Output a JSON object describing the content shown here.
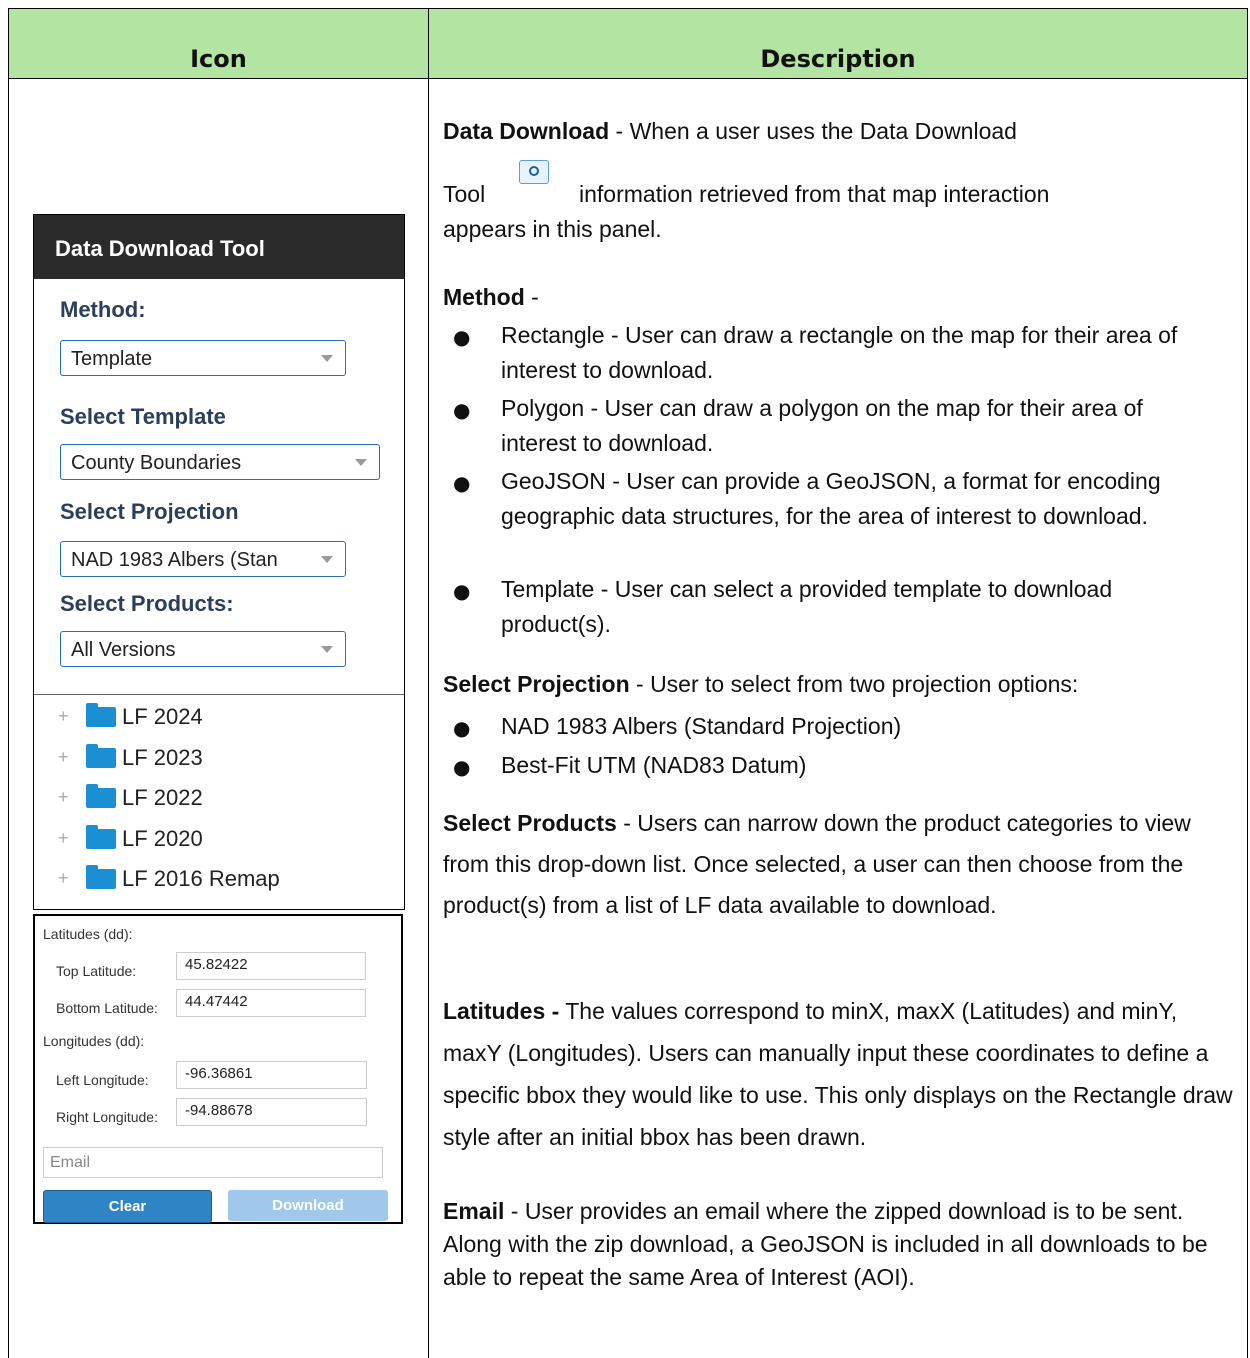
{
  "header": {
    "icon_col": "Icon",
    "description_col": "Description"
  },
  "panel": {
    "title": "Data Download Tool",
    "method_label": "Method:",
    "method_value": "Template",
    "template_label": "Select Template",
    "template_value": "County Boundaries",
    "projection_label": "Select Projection",
    "projection_value": "NAD 1983 Albers (Stan",
    "products_label": "Select Products:",
    "products_value": "All Versions",
    "tree": [
      "LF 2024",
      "LF 2023",
      "LF 2022",
      "LF 2020",
      "LF 2016 Remap"
    ]
  },
  "coords": {
    "lat_heading": "Latitudes (dd):",
    "top_lat_label": "Top Latitude:",
    "top_lat_value": "45.82422",
    "bottom_lat_label": "Bottom Latitude:",
    "bottom_lat_value": "44.47442",
    "lon_heading": "Longitudes (dd):",
    "left_lon_label": "Left Longitude:",
    "left_lon_value": "-96.36861",
    "right_lon_label": "Right Longitude:",
    "right_lon_value": "-94.88678",
    "email_placeholder": "Email",
    "clear_label": "Clear",
    "download_label": "Download",
    "clear_color": "#2f84c6",
    "download_color": "#9fc8ea"
  },
  "description": {
    "data_download_title": "Data Download",
    "data_download_text1": " - When a user uses the Data Download",
    "data_download_text2a": "Tool",
    "data_download_text2b": "information retrieved from that map interaction",
    "data_download_text3": "appears in this panel.",
    "method_title": "Method",
    "method_suffix": " -",
    "method_items": [
      "Rectangle - User can draw a rectangle on the map for their area of interest to download.",
      "Polygon - User can draw a polygon on the map for their area of interest to download.",
      "GeoJSON - User can provide a GeoJSON, a format for encoding geographic data structures, for the area of interest to download.",
      "Template - User can select a provided template to download product(s)."
    ],
    "projection_title": "Select Projection",
    "projection_text": " - User to select from two projection options:",
    "projection_items": [
      "NAD 1983 Albers (Standard Projection)",
      "Best-Fit UTM (NAD83 Datum)"
    ],
    "products_title": "Select Products",
    "products_text": " - Users can narrow down the product categories to view from this drop-down list. Once selected, a user can then choose from the product(s) from a list of LF data available to download.",
    "latitudes_title": "Latitudes -",
    "latitudes_text": " The values correspond to minX, maxX (Latitudes) and minY, maxY (Longitudes). Users can manually input these coordinates to define a specific bbox they would like to use. This only displays on the Rectangle draw style after an initial bbox has been drawn.",
    "email_title": "Email",
    "email_text": " - User provides an email where the zipped download is to be sent. Along with the zip download, a GeoJSON is included in all downloads to be able to repeat the same Area of Interest (AOI)."
  }
}
